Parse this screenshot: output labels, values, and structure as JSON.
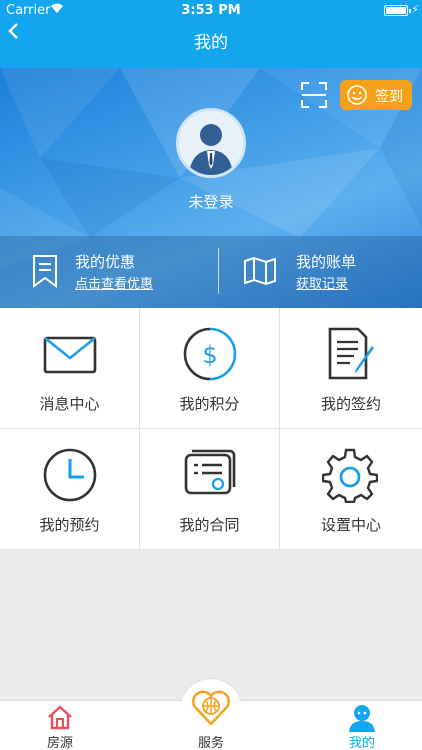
{
  "status_bar": {
    "carrier": "Carrier",
    "time": "3:53 PM"
  },
  "nav": {
    "title": "我的",
    "back_icon": "chevron-left-icon"
  },
  "header": {
    "sign_in_label": "签到",
    "login_status": "未登录"
  },
  "promo": {
    "coupons_title": "我的优惠",
    "coupons_link": "点击查看优惠",
    "bill_title": "我的账单",
    "bill_link": "获取记录"
  },
  "grid": {
    "items": [
      {
        "label": "消息中心",
        "icon": "envelope-icon"
      },
      {
        "label": "我的积分",
        "icon": "dollar-coin-icon"
      },
      {
        "label": "我的签约",
        "icon": "document-pen-icon"
      },
      {
        "label": "我的预约",
        "icon": "clock-icon"
      },
      {
        "label": "我的合同",
        "icon": "contract-card-icon"
      },
      {
        "label": "设置中心",
        "icon": "gear-icon"
      }
    ]
  },
  "tabbar": {
    "tabs": [
      {
        "label": "房源",
        "icon": "house-icon"
      },
      {
        "label": "服务",
        "icon": "heart-basketball-icon"
      },
      {
        "label": "我的",
        "icon": "user-icon"
      }
    ],
    "active_index": 2
  },
  "colors": {
    "primary": "#12a6ee",
    "sign_button": "#f6a11a",
    "house_icon": "#e8505b",
    "service_icon": "#f6a11a"
  }
}
